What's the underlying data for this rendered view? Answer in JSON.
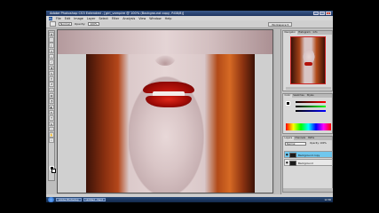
{
  "window": {
    "title": "Adobe Photoshop CS3 Extended - [girl_vampire @ 100% (Background copy, RGB/8)]",
    "minimize_label": "_",
    "maximize_label": "□",
    "close_label": "x"
  },
  "menu": {
    "items": [
      "File",
      "Edit",
      "Image",
      "Layer",
      "Select",
      "Filter",
      "Analysis",
      "View",
      "Window",
      "Help"
    ]
  },
  "options_bar": {
    "field1": "Normal",
    "field2": "100%",
    "label1": "Opacity:",
    "workspace_button": "Workspace ▾"
  },
  "panels": {
    "navigator": {
      "tabs": [
        "Navigator",
        "Histogram",
        "Info"
      ]
    },
    "color": {
      "tabs": [
        "Color",
        "Swatches",
        "Styles"
      ]
    },
    "layers": {
      "tabs": [
        "Layers",
        "Channels",
        "Paths"
      ],
      "blend_mode": "Normal",
      "opacity": "Opacity: 100%",
      "rows": [
        {
          "name": "Background copy",
          "selected": true
        },
        {
          "name": "Background",
          "selected": false
        }
      ]
    }
  },
  "taskbar": {
    "tasks": [
      "Adobe Photoshop",
      "Untitled - Paint"
    ],
    "clock": "12:30"
  },
  "colors": {
    "lip_red": "#c8160e",
    "hair_orange": "#b4471a",
    "selected_layer": "#6fc7ee"
  }
}
